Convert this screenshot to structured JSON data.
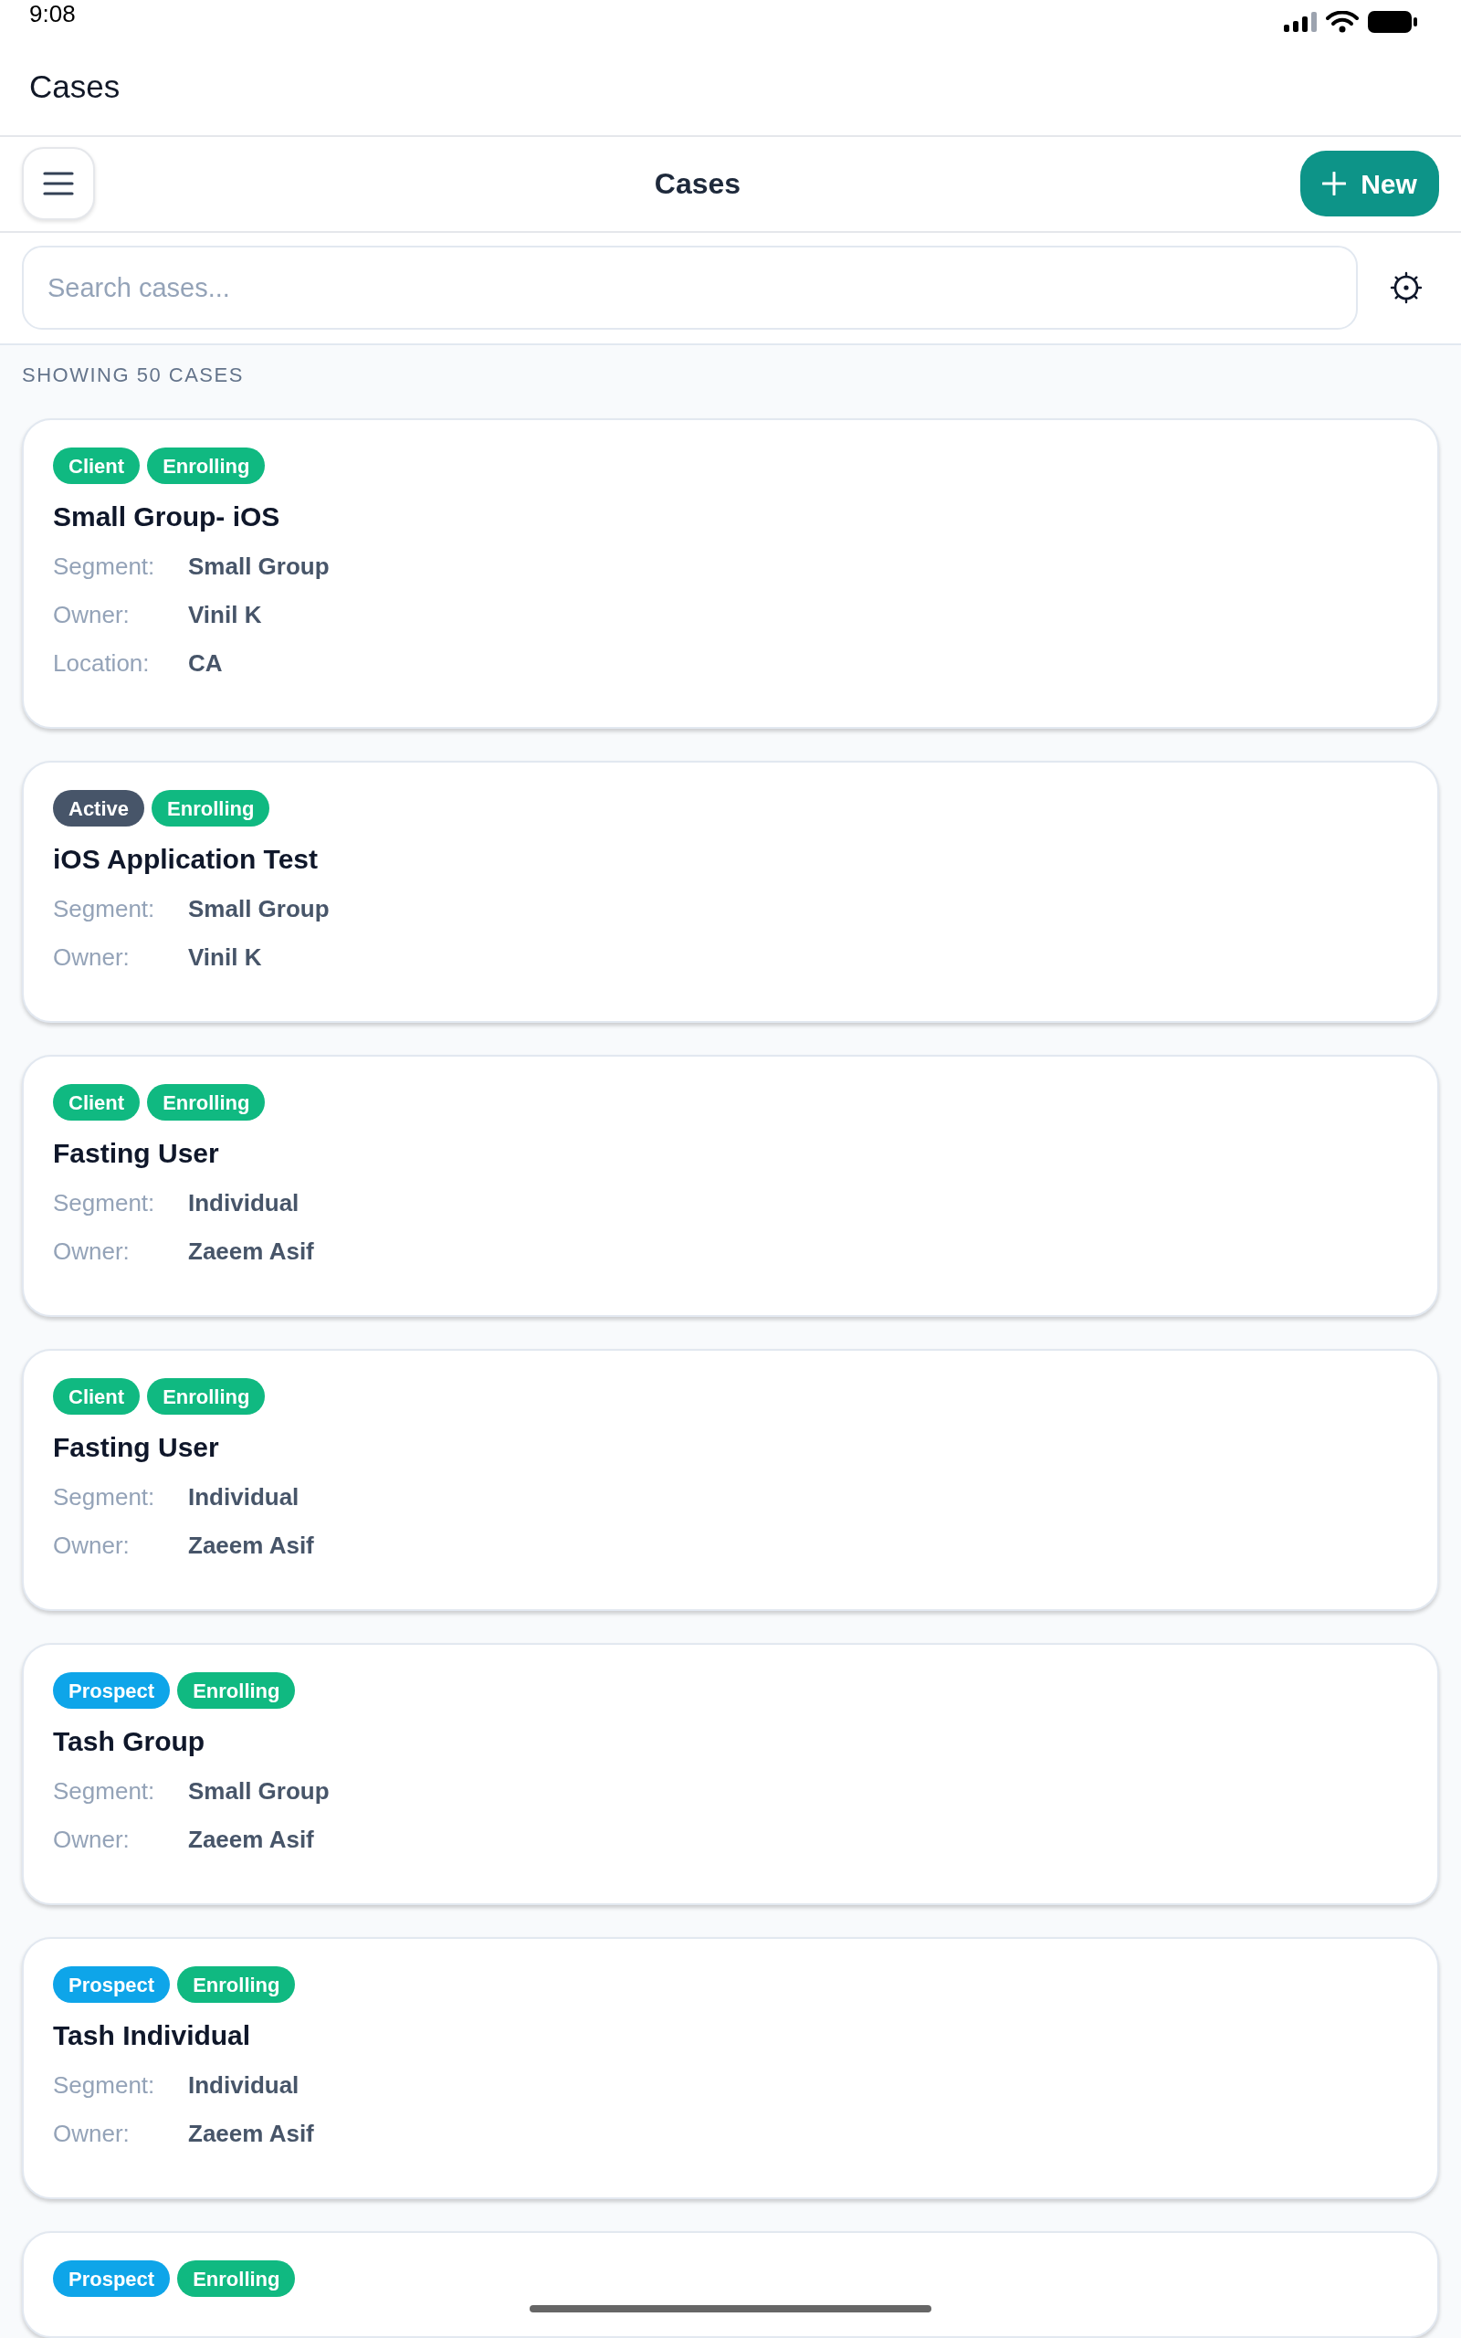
{
  "status_bar": {
    "time": "9:08"
  },
  "page_header": {
    "title": "Cases"
  },
  "toolbar": {
    "title": "Cases",
    "new_button": {
      "label": "New"
    }
  },
  "search": {
    "placeholder": "Search cases..."
  },
  "result_count": "SHOWING 50 CASES",
  "cases": [
    {
      "tags": [
        {
          "label": "Client",
          "color": "#10b981"
        },
        {
          "label": "Enrolling",
          "color": "#10b981"
        }
      ],
      "title": "Small Group- iOS",
      "fields": [
        {
          "label": "Segment:",
          "value": "Small Group"
        },
        {
          "label": "Owner:",
          "value": "Vinil K"
        },
        {
          "label": "Location:",
          "value": "CA"
        }
      ]
    },
    {
      "tags": [
        {
          "label": "Active",
          "color": "#475569"
        },
        {
          "label": "Enrolling",
          "color": "#10b981"
        }
      ],
      "title": "iOS Application Test",
      "fields": [
        {
          "label": "Segment:",
          "value": "Small Group"
        },
        {
          "label": "Owner:",
          "value": "Vinil K"
        }
      ]
    },
    {
      "tags": [
        {
          "label": "Client",
          "color": "#10b981"
        },
        {
          "label": "Enrolling",
          "color": "#10b981"
        }
      ],
      "title": "Fasting User",
      "fields": [
        {
          "label": "Segment:",
          "value": "Individual"
        },
        {
          "label": "Owner:",
          "value": "Zaeem Asif"
        }
      ]
    },
    {
      "tags": [
        {
          "label": "Client",
          "color": "#10b981"
        },
        {
          "label": "Enrolling",
          "color": "#10b981"
        }
      ],
      "title": "Fasting User",
      "fields": [
        {
          "label": "Segment:",
          "value": "Individual"
        },
        {
          "label": "Owner:",
          "value": "Zaeem Asif"
        }
      ]
    },
    {
      "tags": [
        {
          "label": "Prospect",
          "color": "#0ea5e9"
        },
        {
          "label": "Enrolling",
          "color": "#10b981"
        }
      ],
      "title": "Tash Group",
      "fields": [
        {
          "label": "Segment:",
          "value": "Small Group"
        },
        {
          "label": "Owner:",
          "value": "Zaeem Asif"
        }
      ]
    },
    {
      "tags": [
        {
          "label": "Prospect",
          "color": "#0ea5e9"
        },
        {
          "label": "Enrolling",
          "color": "#10b981"
        }
      ],
      "title": "Tash Individual",
      "fields": [
        {
          "label": "Segment:",
          "value": "Individual"
        },
        {
          "label": "Owner:",
          "value": "Zaeem Asif"
        }
      ]
    },
    {
      "tags": [
        {
          "label": "Prospect",
          "color": "#0ea5e9"
        },
        {
          "label": "Enrolling",
          "color": "#10b981"
        }
      ]
    }
  ]
}
